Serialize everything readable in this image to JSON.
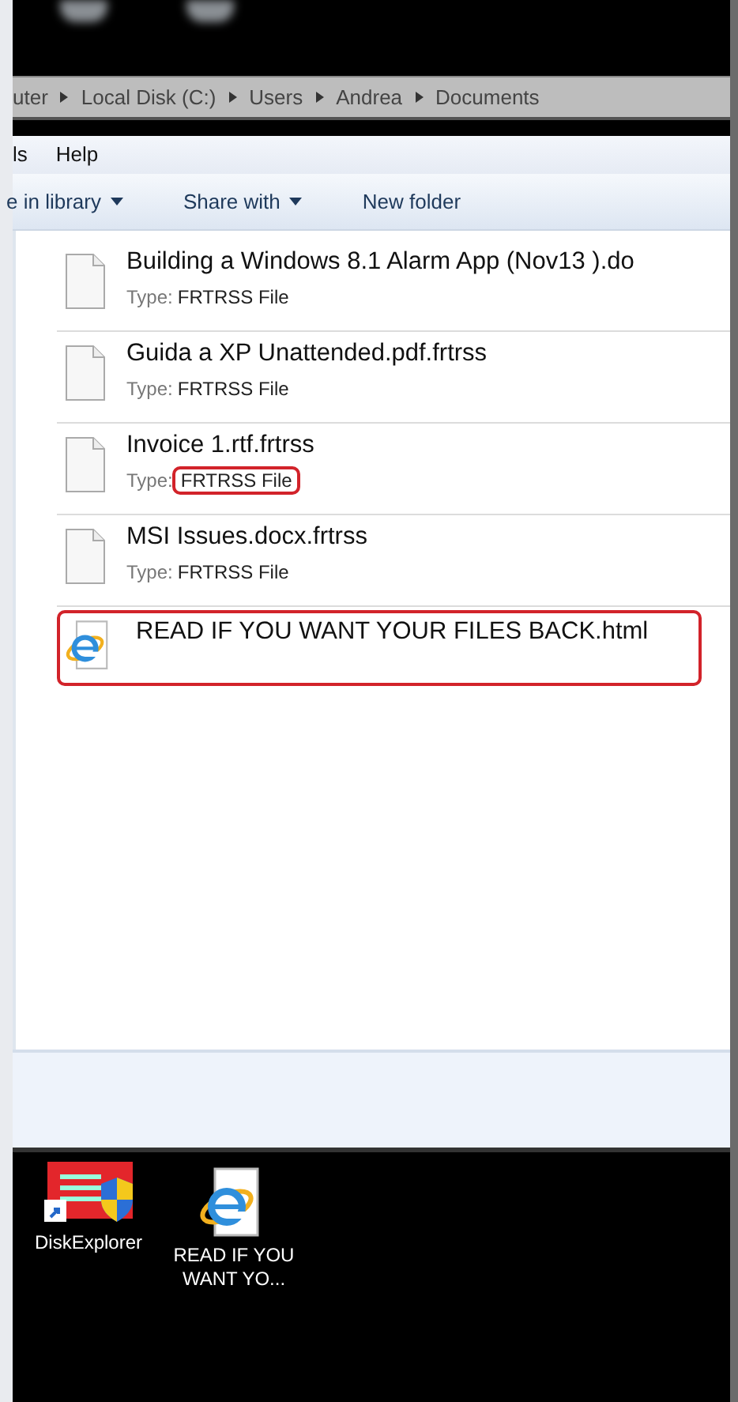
{
  "address_bar": {
    "crumbs": [
      "uter",
      "Local Disk (C:)",
      "Users",
      "Andrea",
      "Documents"
    ]
  },
  "menu_bar": [
    "ls",
    "Help"
  ],
  "toolbar": [
    {
      "label": "e in library",
      "dropdown": true
    },
    {
      "label": "Share with",
      "dropdown": true
    },
    {
      "label": "New folder",
      "dropdown": false
    }
  ],
  "files": [
    {
      "kind": "document",
      "name": "Building a Windows 8.1 Alarm App (Nov13 ).do",
      "type_label": "Type:",
      "type": "FRTRSS File",
      "highlighted": false,
      "type_highlighted": false
    },
    {
      "kind": "document",
      "name": "Guida a XP Unattended.pdf.frtrss",
      "type_label": "Type:",
      "type": "FRTRSS File",
      "highlighted": false,
      "type_highlighted": false
    },
    {
      "kind": "document",
      "name": "Invoice 1.rtf.frtrss",
      "type_label": "Type:",
      "type": "FRTRSS File",
      "highlighted": false,
      "type_highlighted": true
    },
    {
      "kind": "document",
      "name": "MSI Issues.docx.frtrss",
      "type_label": "Type:",
      "type": "FRTRSS File",
      "highlighted": false,
      "type_highlighted": false
    },
    {
      "kind": "html",
      "name": "READ IF YOU WANT YOUR FILES BACK.html",
      "highlighted": true
    }
  ],
  "desktop_icons": [
    {
      "kind": "app",
      "label": "DiskExplorer"
    },
    {
      "kind": "html",
      "label": "READ IF YOU WANT YO..."
    }
  ]
}
